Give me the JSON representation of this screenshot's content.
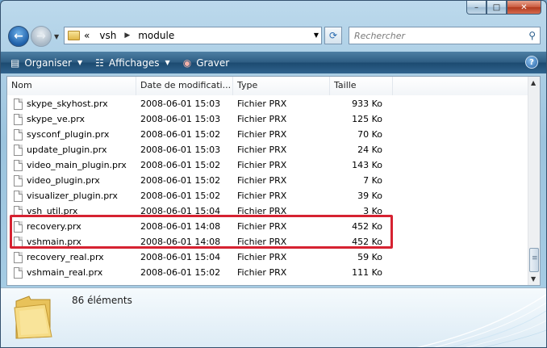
{
  "window": {
    "caption_buttons": {
      "minimize": "–",
      "maximize": "□",
      "close": "✕"
    }
  },
  "address_bar": {
    "crumbs": [
      "«",
      "vsh",
      "module"
    ],
    "search_placeholder": "Rechercher"
  },
  "toolbar": {
    "organise_label": "Organiser",
    "views_label": "Affichages",
    "burn_label": "Graver",
    "help_label": "?"
  },
  "columns": [
    "Nom",
    "Date de modificati...",
    "Type",
    "Taille"
  ],
  "files": [
    {
      "name": "skype_skyhost.prx",
      "date": "2008-06-01 15:03",
      "type": "Fichier PRX",
      "size": "933 Ko"
    },
    {
      "name": "skype_ve.prx",
      "date": "2008-06-01 15:03",
      "type": "Fichier PRX",
      "size": "125 Ko"
    },
    {
      "name": "sysconf_plugin.prx",
      "date": "2008-06-01 15:02",
      "type": "Fichier PRX",
      "size": "70 Ko"
    },
    {
      "name": "update_plugin.prx",
      "date": "2008-06-01 15:03",
      "type": "Fichier PRX",
      "size": "24 Ko"
    },
    {
      "name": "video_main_plugin.prx",
      "date": "2008-06-01 15:02",
      "type": "Fichier PRX",
      "size": "143 Ko"
    },
    {
      "name": "video_plugin.prx",
      "date": "2008-06-01 15:02",
      "type": "Fichier PRX",
      "size": "7 Ko"
    },
    {
      "name": "visualizer_plugin.prx",
      "date": "2008-06-01 15:02",
      "type": "Fichier PRX",
      "size": "39 Ko"
    },
    {
      "name": "vsh_util.prx",
      "date": "2008-06-01 15:04",
      "type": "Fichier PRX",
      "size": "3 Ko"
    },
    {
      "name": "recovery.prx",
      "date": "2008-06-01 14:08",
      "type": "Fichier PRX",
      "size": "452 Ko"
    },
    {
      "name": "vshmain.prx",
      "date": "2008-06-01 14:08",
      "type": "Fichier PRX",
      "size": "452 Ko"
    },
    {
      "name": "recovery_real.prx",
      "date": "2008-06-01 15:04",
      "type": "Fichier PRX",
      "size": "59 Ko"
    },
    {
      "name": "vshmain_real.prx",
      "date": "2008-06-01 15:02",
      "type": "Fichier PRX",
      "size": "111 Ko"
    }
  ],
  "details": {
    "count_text": "86 éléments"
  },
  "colors": {
    "highlight": "#d62231",
    "toolbar": "#2d5c82"
  }
}
